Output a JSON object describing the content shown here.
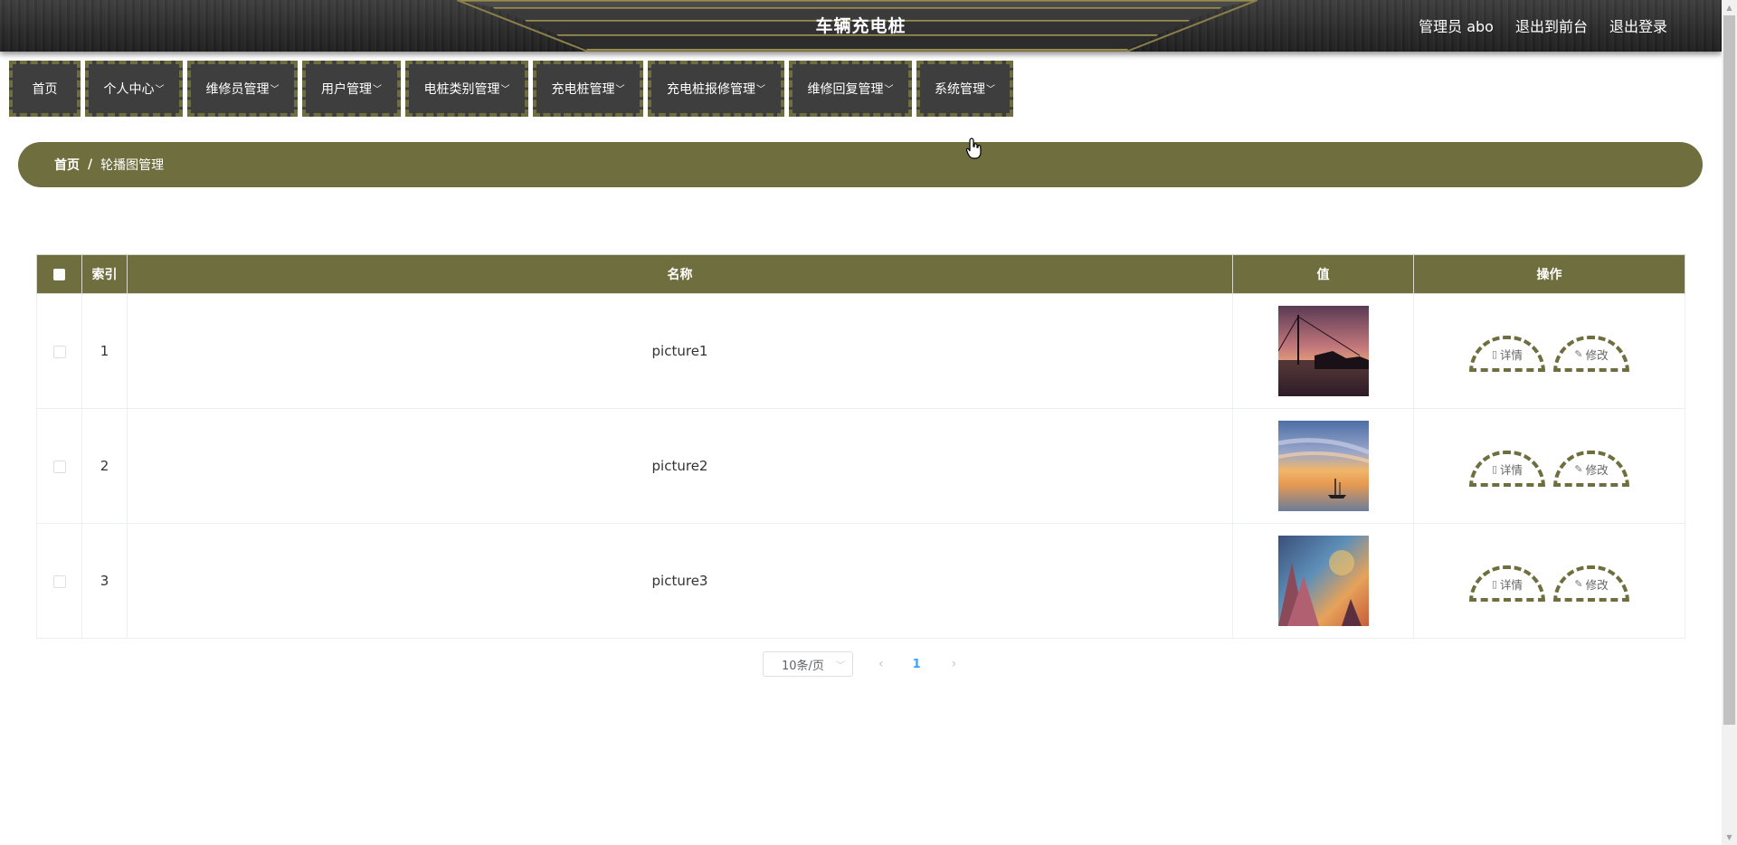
{
  "header": {
    "title": "车辆充电桩",
    "user_label": "管理员 abo",
    "to_front_label": "退出到前台",
    "logout_label": "退出登录"
  },
  "nav": {
    "items": [
      {
        "label": "首页",
        "dropdown": false
      },
      {
        "label": "个人中心",
        "dropdown": true
      },
      {
        "label": "维修员管理",
        "dropdown": true
      },
      {
        "label": "用户管理",
        "dropdown": true
      },
      {
        "label": "电桩类别管理",
        "dropdown": true
      },
      {
        "label": "充电桩管理",
        "dropdown": true
      },
      {
        "label": "充电桩报修管理",
        "dropdown": true
      },
      {
        "label": "维修回复管理",
        "dropdown": true
      },
      {
        "label": "系统管理",
        "dropdown": true
      }
    ]
  },
  "breadcrumb": {
    "home": "首页",
    "separator": "/",
    "current": "轮播图管理"
  },
  "table": {
    "headers": {
      "index": "索引",
      "name": "名称",
      "value": "值",
      "actions": "操作"
    },
    "rows": [
      {
        "index": "1",
        "name": "picture1",
        "thumb": "sunset-bridge"
      },
      {
        "index": "2",
        "name": "picture2",
        "thumb": "boat-sunset"
      },
      {
        "index": "3",
        "name": "picture3",
        "thumb": "colorful-peaks"
      }
    ],
    "detail_label": "详情",
    "edit_label": "修改"
  },
  "pagination": {
    "page_size": "10条/页",
    "current_page": "1"
  },
  "colors": {
    "accent": "#6e6e3e",
    "header_bg": "#2a2a2a",
    "nav_bg": "#3e3e3e",
    "page_active": "#409eff"
  },
  "icons": {
    "detail": "document-icon",
    "edit": "pencil-icon",
    "prev": "chevron-left-icon",
    "next": "chevron-right-icon",
    "dropdown": "chevron-down-icon"
  }
}
